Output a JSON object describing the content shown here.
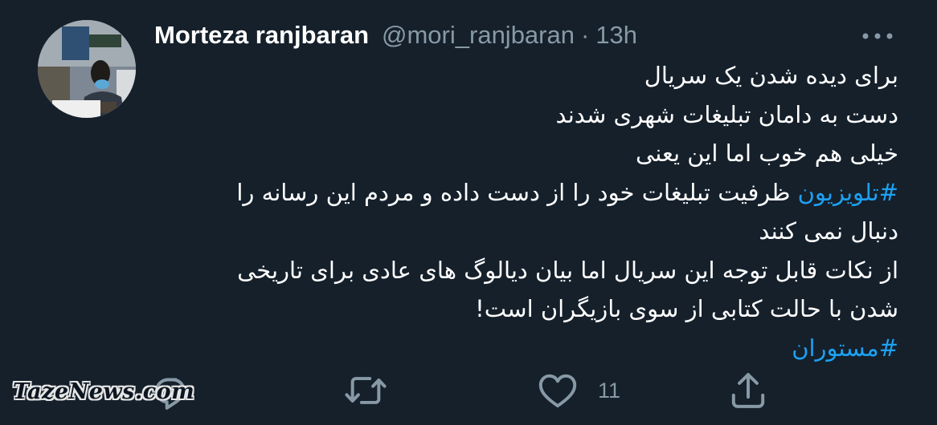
{
  "tweet": {
    "author": {
      "display_name": "Morteza ranjbaran",
      "handle": "@mori_ranjbaran",
      "separator": "·",
      "time": "13h"
    },
    "body": {
      "line1": "برای دیده شدن یک سریال",
      "line2": "دست به دامان تبلیغات شهری شدند",
      "line3": "خیلی هم خوب اما این یعنی",
      "line4_hashtag": "#تلویزیون",
      "line4_rest": " ظرفیت تبلیغات خود را از دست داده و مردم این رسانه را",
      "line5": "دنبال نمی کنند",
      "line6": "از نکات قابل توجه این سریال اما بیان دیالوگ های عادی برای تاریخی",
      "line7": "شدن با حالت کتابی از سوی بازیگران است!",
      "line8_hashtag": "#مستوران"
    },
    "actions": {
      "reply_icon": "reply-icon",
      "retweet_icon": "retweet-icon",
      "like_icon": "heart-icon",
      "like_count": "11",
      "share_icon": "share-icon"
    },
    "more_icon": "more-horizontal-icon"
  },
  "watermark": {
    "text": "TazeNews.com"
  },
  "colors": {
    "background": "#15202b",
    "text": "#ffffff",
    "secondary": "#8899a6",
    "accent": "#1da1f2"
  }
}
